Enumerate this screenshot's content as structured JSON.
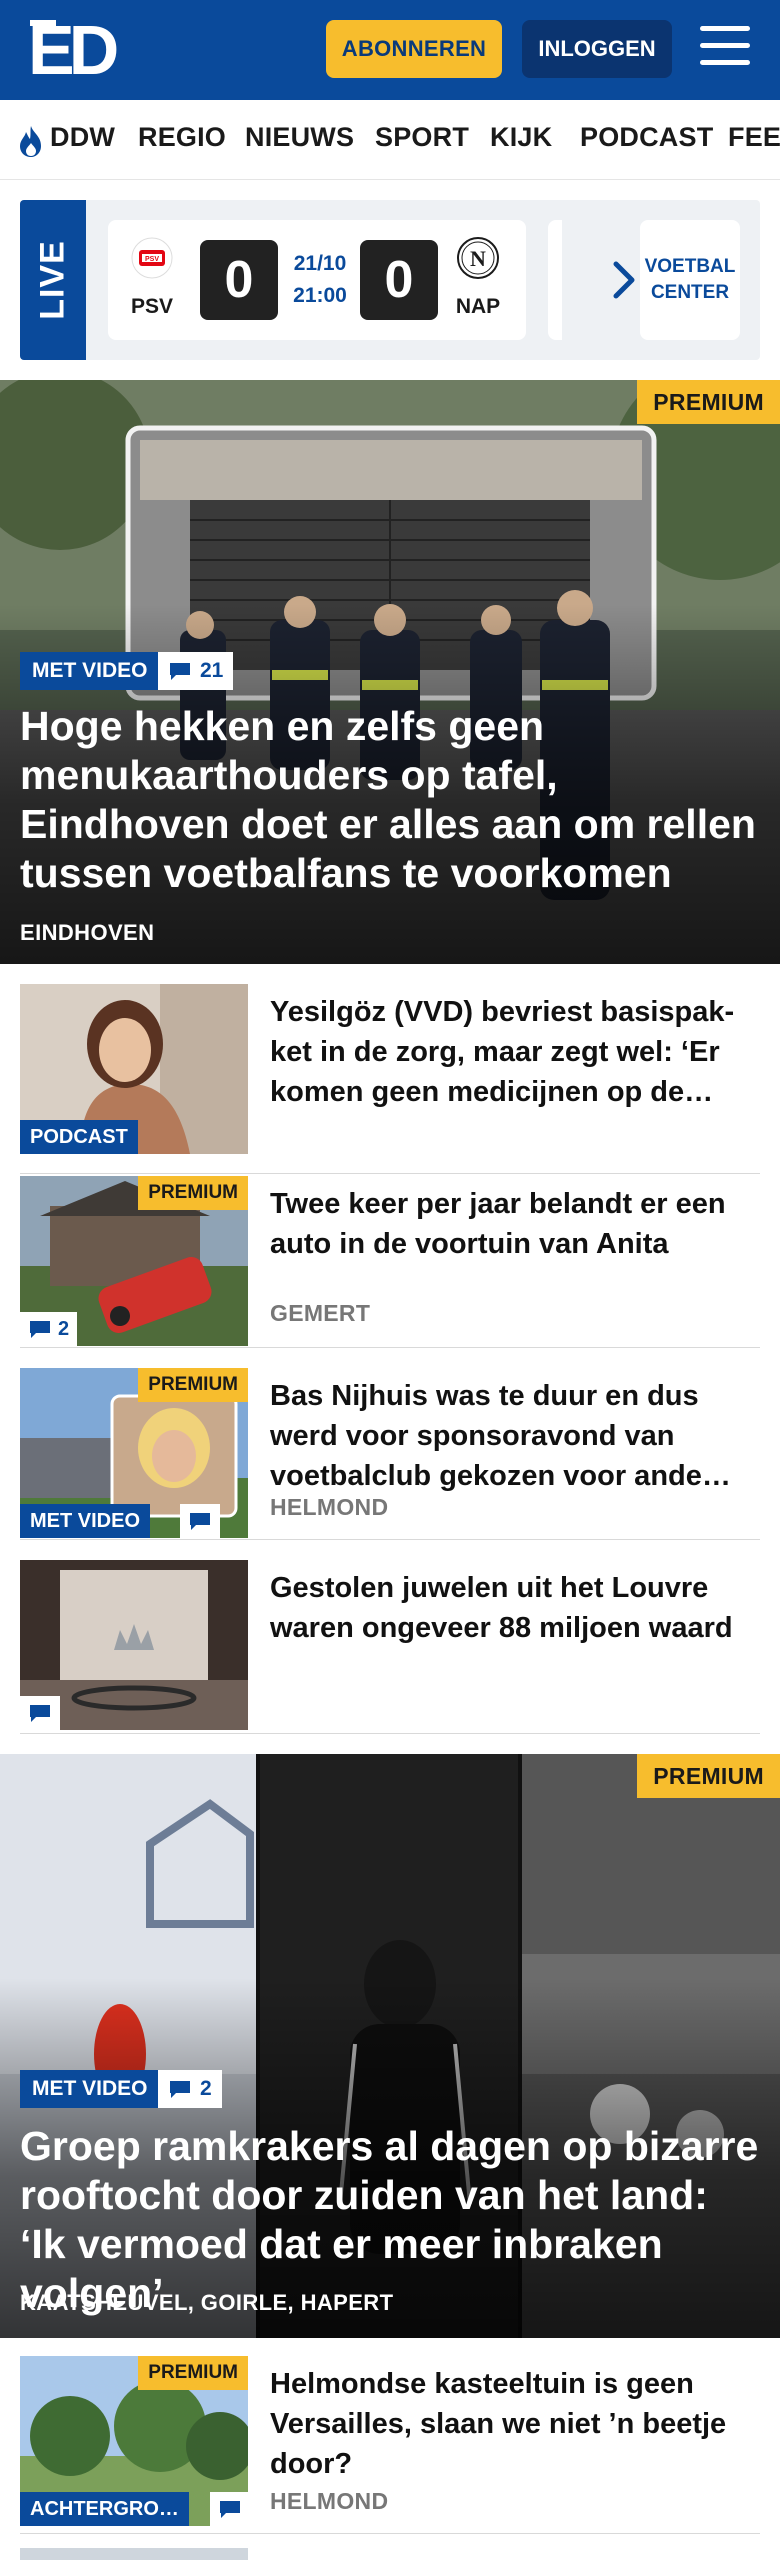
{
  "header": {
    "logo_text": "ED",
    "subscribe_label": "ABONNEREN",
    "login_label": "INLOGGEN",
    "brand_color": "#0a4a9b",
    "accent_color": "#f7bd2d"
  },
  "nav": {
    "items": [
      "DDW",
      "REGIO",
      "NIEUWS",
      "SPORT",
      "KIJK",
      "PODCAST",
      "FEE"
    ]
  },
  "live": {
    "label": "LIVE",
    "match": {
      "home_team": "PSV",
      "home_score": "0",
      "date": "21/10",
      "time": "21:00",
      "away_score": "0",
      "away_team": "NAP"
    },
    "center_label_1": "VOETBAL",
    "center_label_2": "CENTER"
  },
  "hero1": {
    "premium": "PREMIUM",
    "video_badge": "MET VIDEO",
    "comment_count": "21",
    "title": "Hoge hekken en zelfs geen menukaarthouders op tafel, Eindhoven doet er alles aan om rellen tussen voetbalfans te voorkomen",
    "location": "EINDHOVEN"
  },
  "articles": [
    {
      "title": "Yesilgöz (VVD) bevriest basispak-ket in de zorg, maar zegt wel: ‘Er komen geen medicijnen op de…",
      "badge": "PODCAST",
      "premium": "",
      "comments": "",
      "location": ""
    },
    {
      "title": "Twee keer per jaar belandt er een auto in de voortuin van Anita",
      "badge": "",
      "premium": "PREMIUM",
      "comments": "2",
      "location": "GEMERT"
    },
    {
      "title": "Bas Nijhuis was te duur en dus werd voor sponsoravond van voetbalclub gekozen voor ande…",
      "badge": "MET VIDEO",
      "premium": "PREMIUM",
      "comments": "",
      "location": "HELMOND"
    },
    {
      "title": "Gestolen juwelen uit het Louvre waren ongeveer 88 miljoen waard",
      "badge": "",
      "premium": "",
      "comments": "",
      "location": ""
    }
  ],
  "hero2": {
    "premium": "PREMIUM",
    "video_badge": "MET VIDEO",
    "comment_count": "2",
    "title": "Groep ramkrakers al dagen op bizarre rooftocht door zuiden van het land: ‘Ik vermoed dat er meer inbraken volgen’",
    "location": "KAATSHEUVEL, GOIRLE, HAPERT"
  },
  "article5": {
    "title": "Helmondse kasteeltuin is geen Versailles, slaan we niet ’n beetje door?",
    "badge": "ACHTERGRO…",
    "premium": "PREMIUM",
    "location": "HELMOND"
  }
}
